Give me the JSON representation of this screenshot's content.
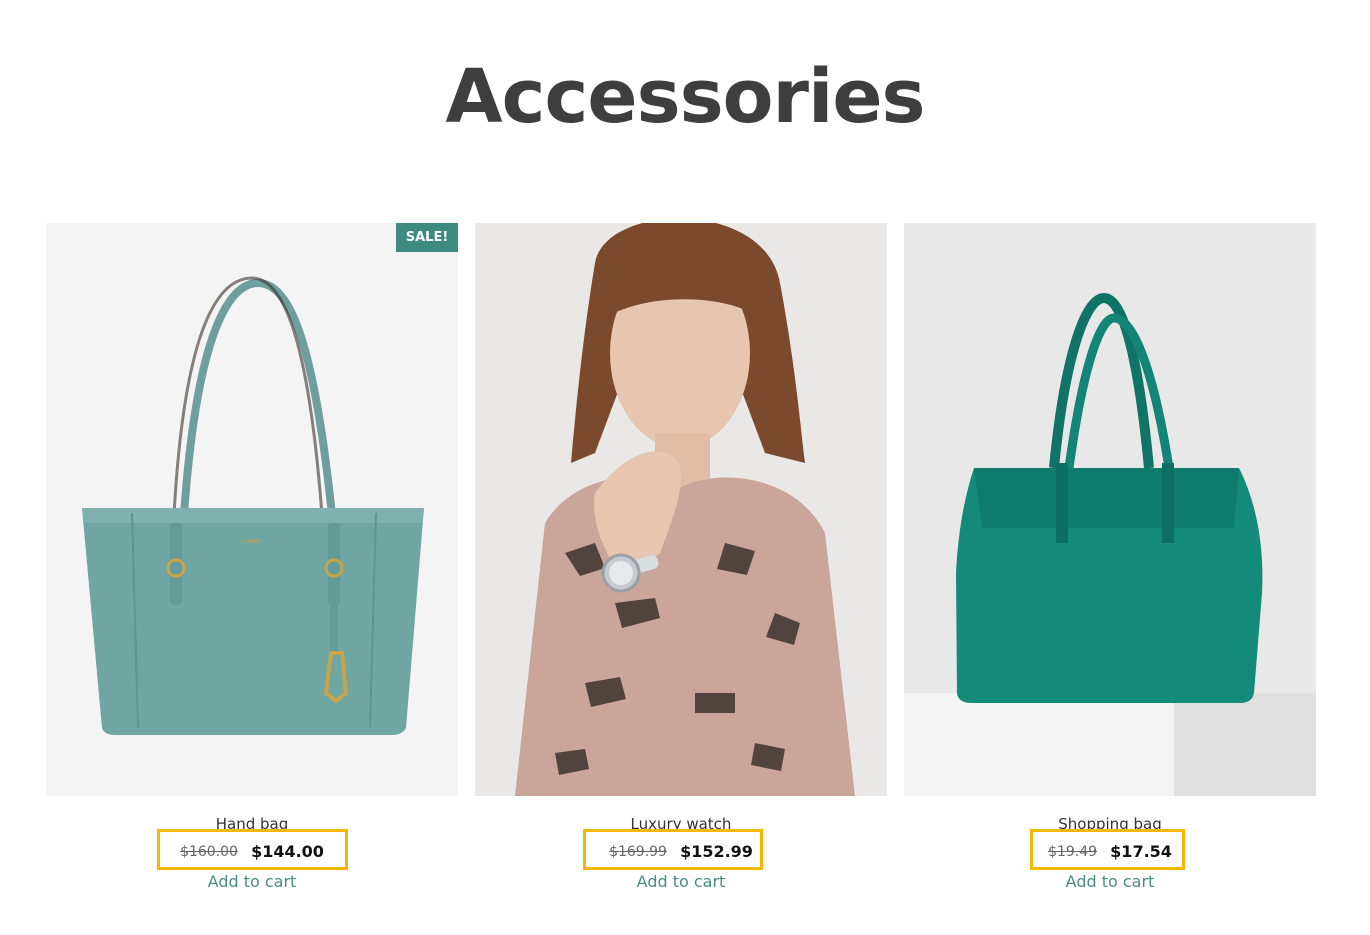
{
  "page": {
    "title": "Accessories"
  },
  "products": [
    {
      "name": "Hand bag",
      "badge": "SALE!",
      "price_old": "$160.00",
      "price_new": "$144.00",
      "cta": "Add to cart",
      "image": "teal-tote-handbag"
    },
    {
      "name": "Luxury watch",
      "price_old": "$169.99",
      "price_new": "$152.99",
      "cta": "Add to cart",
      "image": "woman-wearing-watch"
    },
    {
      "name": "Shopping bag",
      "price_old": "$19.49",
      "price_new": "$17.54",
      "cta": "Add to cart",
      "image": "green-shopping-bag"
    }
  ],
  "colors": {
    "accent": "#3d8b80",
    "link": "#4a8c84",
    "highlight": "#f5b800",
    "title": "#3e3e3e"
  }
}
